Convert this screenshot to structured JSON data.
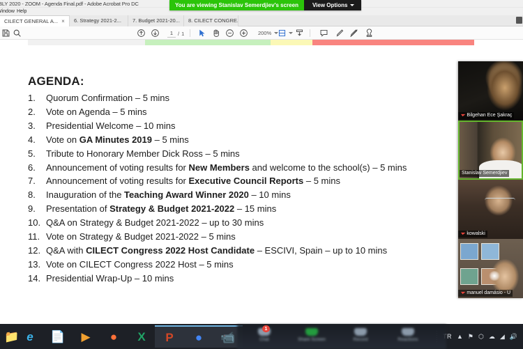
{
  "window": {
    "title": "BLY 2020 - ZOOM - Agenda Final.pdf - Adobe Acrobat Pro DC",
    "menu_window": "Window",
    "menu_help": "Help"
  },
  "share_banner": {
    "message": "You are viewing Stanislav Semerdjiev's screen",
    "view_options": "View Options",
    "caret_icon": "chevron-down-icon",
    "green": "#2bc40a",
    "dark": "#1b1b1b"
  },
  "tabs": [
    {
      "label": "CILECT GENERAL A...",
      "close_icon": "close-icon",
      "active": true
    },
    {
      "label": "6. Strategy 2021-2...",
      "active": false
    },
    {
      "label": "7. Budget 2021-20...",
      "active": false
    },
    {
      "label": "8. CILECT CONGRE...",
      "active": false
    }
  ],
  "toolbar": {
    "icons": [
      "save-icon",
      "search-icon",
      "previous-page-icon",
      "next-page-icon",
      "select-tool-icon",
      "hand-tool-icon",
      "zoom-out-icon",
      "zoom-in-icon",
      "fit-page-icon",
      "page-display-icon",
      "scroll-mode-icon",
      "comment-icon",
      "highlight-icon",
      "draw-icon",
      "stamp-icon"
    ],
    "page_current": "1",
    "page_separator": "/",
    "page_total": "1",
    "zoom_level": "200%"
  },
  "document": {
    "title": "AGENDA:",
    "colorbar": {
      "grey": "#f1f1f1",
      "green": "#c6f0bd",
      "yellow": "#fbf8b6",
      "red": "#f9847f"
    },
    "items": [
      {
        "num": "1.",
        "html": "Quorum Confirmation &#8211; 5 mins"
      },
      {
        "num": "2.",
        "html": "Vote on Agenda &#8211; 5 mins"
      },
      {
        "num": "3.",
        "html": "Presidential Welcome &#8211; 10 mins"
      },
      {
        "num": "4.",
        "html": "Vote on <b>GA Minutes 2019</b> &#8211; 5 mins"
      },
      {
        "num": "5.",
        "html": "Tribute to Honorary Member Dick Ross &#8211; 5 mins"
      },
      {
        "num": "6.",
        "html": "Announcement of voting results for <b>New Members</b> and welcome to the school(s) &#8211; 5 mins"
      },
      {
        "num": "7.",
        "html": "Announcement of voting results for <b>Executive Council Reports</b> &#8211; 5 mins"
      },
      {
        "num": "8.",
        "html": "Inauguration of the <b>Teaching Award Winner 2020</b> &#8211; 10 mins"
      },
      {
        "num": "9.",
        "html": "Presentation of <b>Strategy &amp; Budget 2021-2022</b> &#8211; 15 mins"
      },
      {
        "num": "10.",
        "html": "Q&amp;A on Strategy &amp; Budget 2021-2022 &#8211; up to 30 mins"
      },
      {
        "num": "11.",
        "html": "Vote on Strategy &amp; Budget 2021-2022 &#8211; 5 mins"
      },
      {
        "num": "12.",
        "html": "Q&amp;A with <b>CILECT Congress 2022 Host Candidate</b> &#8211; ESCIVI, Spain &#8211; up to 10 mins"
      },
      {
        "num": "13.",
        "html": "Vote on CILECT Congress 2022 Host &#8211; 5 mins"
      },
      {
        "num": "14.",
        "html": "Presidential Wrap-Up &#8211; 10 mins"
      }
    ]
  },
  "video_strip": {
    "active_speaker_color": "#64b42d",
    "participants": [
      {
        "name": "Bilgehan Ece Şakraç",
        "muted": true,
        "mic_icon": "microphone-muted-icon",
        "active": false
      },
      {
        "name": "Stanislav Semerdjiev",
        "muted": false,
        "mic_icon": "microphone-icon",
        "active": true
      },
      {
        "name": "kowalski",
        "muted": true,
        "mic_icon": "microphone-muted-icon",
        "active": false
      },
      {
        "name": "manuel damásio - U",
        "muted": true,
        "mic_icon": "microphone-muted-icon",
        "active": false
      }
    ]
  },
  "zoom_controls": {
    "buttons": [
      {
        "label": "Chat",
        "icon": "chat-icon",
        "badge": "1"
      },
      {
        "label": "Share Screen",
        "icon": "share-screen-icon",
        "badge": ""
      },
      {
        "label": "Record",
        "icon": "record-icon",
        "badge": ""
      },
      {
        "label": "Reactions",
        "icon": "reactions-icon",
        "badge": ""
      }
    ]
  },
  "taskbar": {
    "apps": [
      {
        "icon": "file-explorer-icon",
        "glyph": "📁",
        "color": "#f0c06a",
        "open": false
      },
      {
        "icon": "internet-explorer-icon",
        "glyph": "e",
        "color": "#3bb3ea",
        "open": false
      },
      {
        "icon": "adobe-acrobat-icon",
        "glyph": "📄",
        "color": "#dce7f2",
        "open": false
      },
      {
        "icon": "media-player-icon",
        "glyph": "▶",
        "color": "#f0a030",
        "open": false
      },
      {
        "icon": "firefox-icon",
        "glyph": "●",
        "color": "#ff7139",
        "open": false
      },
      {
        "icon": "excel-icon",
        "glyph": "X",
        "color": "#21a366",
        "open": false
      },
      {
        "icon": "powerpoint-icon",
        "glyph": "P",
        "color": "#d24726",
        "open": true
      },
      {
        "icon": "chrome-icon",
        "glyph": "●",
        "color": "#4285f4",
        "open": true
      },
      {
        "icon": "zoom-icon",
        "glyph": "📹",
        "color": "#2d8cff",
        "open": true
      }
    ],
    "tray": {
      "grip_icon": "tray-grip-icon",
      "language": "TR",
      "items": [
        {
          "icon": "show-hidden-icons-icon",
          "glyph": "▲"
        },
        {
          "icon": "flag-icon",
          "glyph": "⚑"
        },
        {
          "icon": "dropbox-icon",
          "glyph": "⬡"
        },
        {
          "icon": "onedrive-icon",
          "glyph": "☁"
        },
        {
          "icon": "network-icon",
          "glyph": "◢"
        },
        {
          "icon": "volume-icon",
          "glyph": "🔊"
        }
      ]
    }
  }
}
